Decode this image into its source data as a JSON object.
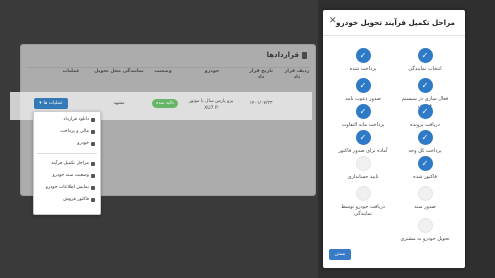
{
  "page": {
    "title": "قراردادها",
    "columns": [
      "ردیف قرار داد",
      "تاریخ قرار داد",
      "خودرو",
      "وضعیت",
      "نمایندگی محل تحویل",
      "عملیات"
    ],
    "row": {
      "index": "",
      "date": "۱۴۰۱/۰۷/۲۳",
      "car": "پژو پارس سال با موتور XU7 P",
      "status": "تاکید شده",
      "dealer": "مشهد",
      "actions_label": "عملیات ها"
    },
    "menu_items": [
      "دانلود قرارداد",
      "مالی و پرداخت",
      "خودرو",
      "مراحل تکمیل فرآیند",
      "وضعیت سند خودرو",
      "نمایش اطلاعات خودرو",
      "فاکتور فروش"
    ]
  },
  "panel": {
    "title": "مراحل تکمیل فرآیند تحویل خودرو",
    "back_label": "بستن",
    "steps": [
      {
        "label": "انتخاب نمایندگی",
        "done": true
      },
      {
        "label": "پرداخت شده",
        "done": true
      },
      {
        "label": "فعال سازی در سیستم فروش",
        "done": true
      },
      {
        "label": "صدور دعوت نامه",
        "done": true
      },
      {
        "label": "دریافت پرونده",
        "done": true
      },
      {
        "label": "پرداخت مابه التفاوت",
        "done": true
      },
      {
        "label": "پرداخت کل وجه",
        "done": true
      },
      {
        "label": "آماده برای صدور فاکتور",
        "done": true
      },
      {
        "label": "فاکتور شده",
        "done": true
      },
      {
        "label": "تایید حسابداری",
        "done": false
      },
      {
        "label": "صدور سند",
        "done": false
      },
      {
        "label": "دریافت خودرو توسط نمایندگی",
        "done": false
      },
      {
        "label": "تحویل خودرو به مشتری",
        "done": false
      }
    ]
  }
}
